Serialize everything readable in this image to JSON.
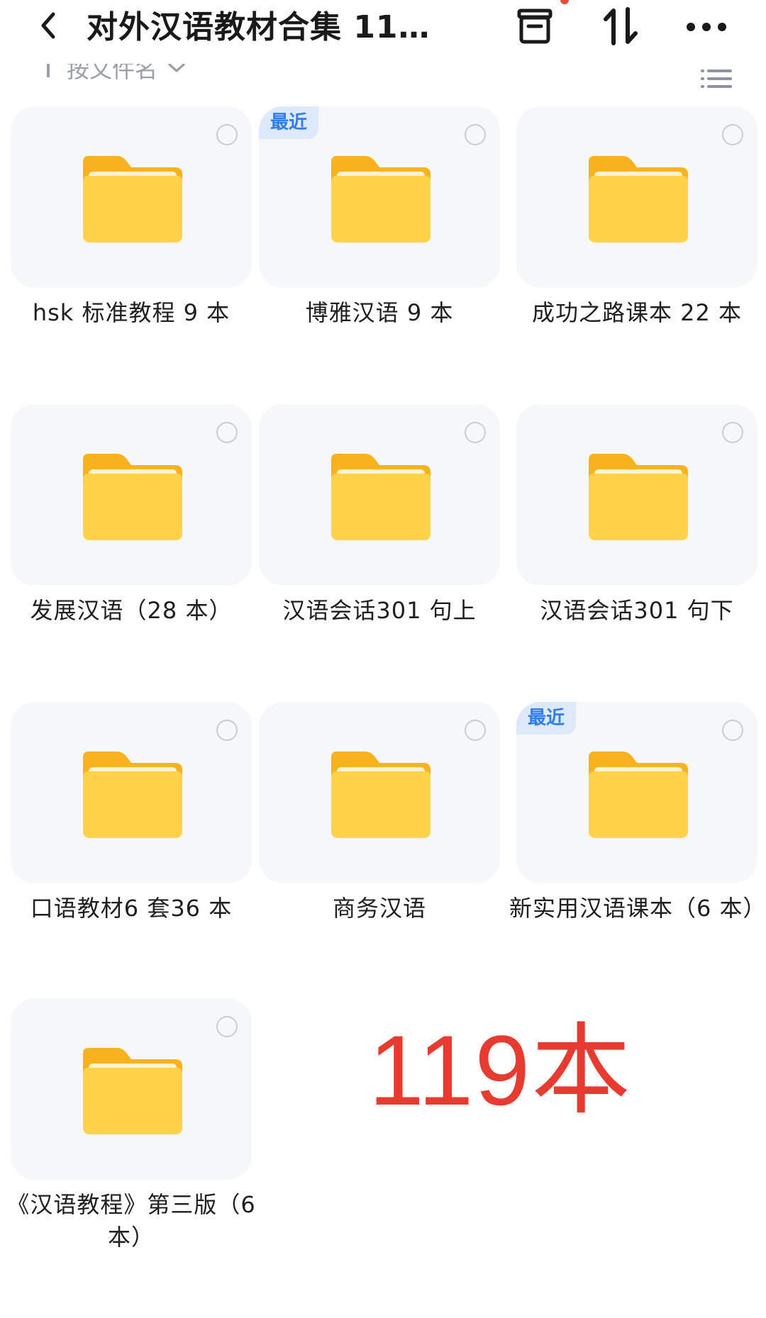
{
  "header": {
    "title": "对外汉语教材合集  11…"
  },
  "subbar": {
    "sort_label": "按文件名"
  },
  "folders": [
    {
      "name": "hsk 标准教程 9 本",
      "recent": false
    },
    {
      "name": "博雅汉语  9 本",
      "recent": true
    },
    {
      "name": "成功之路课本 22 本",
      "recent": false
    },
    {
      "name": "发展汉语（28 本）",
      "recent": false
    },
    {
      "name": "汉语会话301 句上",
      "recent": false
    },
    {
      "name": "汉语会话301 句下",
      "recent": false
    },
    {
      "name": "口语教材6 套36 本",
      "recent": false
    },
    {
      "name": "商务汉语",
      "recent": false
    },
    {
      "name": "新实用汉语课本（6 本）",
      "recent": true
    },
    {
      "name": "《汉语教程》第三版（6 本）",
      "recent": false
    }
  ],
  "badge_label": "最近",
  "overlay_text": "119本",
  "colors": {
    "accent_blue": "#2f7cf0",
    "folder_yellow": "#ffd24a",
    "overlay_red": "#e63b2e"
  },
  "icons": [
    "back-icon",
    "archive-icon",
    "sort-icon",
    "more-icon",
    "folder-icon",
    "list-view-icon"
  ]
}
